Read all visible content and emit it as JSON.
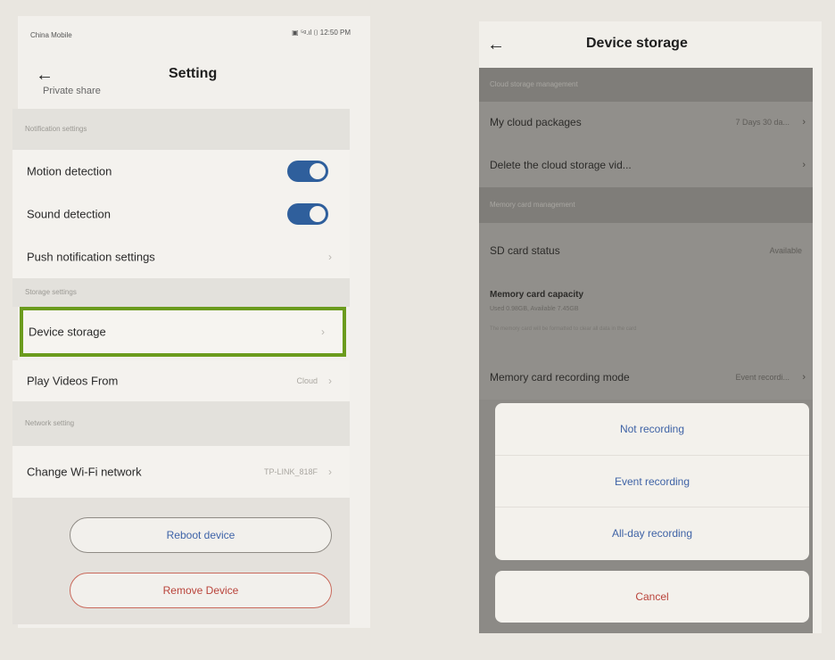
{
  "left": {
    "status": {
      "carrier": "China Mobile",
      "right": "▣ ⁵ᵍ.ıl ⌷ 12:50 PM"
    },
    "title": "Setting",
    "back_icon": "←",
    "peek_text": "Private share",
    "sections": {
      "notification": "Notification settings",
      "storage": "Storage settings",
      "network": "Network setting"
    },
    "rows": {
      "motion": "Motion detection",
      "sound": "Sound detection",
      "push": "Push notification settings",
      "device_storage": "Device storage",
      "play_videos": "Play Videos From",
      "play_videos_value": "Cloud",
      "wifi": "Change Wi-Fi network",
      "wifi_value": "TP-LINK_818F"
    },
    "toggles": {
      "motion": true,
      "sound": true
    },
    "buttons": {
      "reboot": "Reboot device",
      "remove": "Remove Device"
    },
    "chevron": "›",
    "colors": {
      "toggle_on": "#2f5f9c",
      "highlight": "#6b9b1d",
      "link_blue": "#3e63a8",
      "danger": "#b9433a"
    }
  },
  "right": {
    "title": "Device storage",
    "back_icon": "←",
    "sections": {
      "cloud": "Cloud storage management",
      "memory": "Memory card management"
    },
    "rows": {
      "cloud_packages": "My cloud packages",
      "cloud_packages_value": "7 Days 30 da...",
      "delete_cloud": "Delete the cloud storage vid...",
      "sd_status": "SD card status",
      "sd_status_value": "Available",
      "capacity": "Memory card capacity",
      "capacity_sub": "Used 0.98GB, Available 7.45GB",
      "capacity_note": "The memory card will be formatted to clear all data in the card",
      "rec_mode": "Memory card recording mode",
      "rec_mode_value": "Event recordi..."
    },
    "chevron": "›",
    "sheet_options": [
      "Not recording",
      "Event recording",
      "All-day recording"
    ],
    "cancel": "Cancel"
  }
}
